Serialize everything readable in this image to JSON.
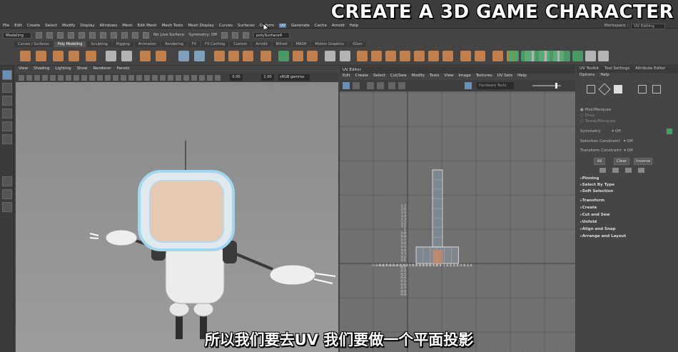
{
  "banner": "CREATE A 3D GAME CHARACTER",
  "menu": [
    "File",
    "Edit",
    "Create",
    "Select",
    "Modify",
    "Display",
    "Windows",
    "Mesh",
    "Edit Mesh",
    "Mesh Tools",
    "Mesh Display",
    "Curves",
    "Surfaces",
    "Deform",
    "UV",
    "Generate",
    "Cache",
    "Arnold",
    "Help"
  ],
  "menu_highlight": "UV",
  "workspace": {
    "label": "Workspace :",
    "value": "UV Editing"
  },
  "statusline": {
    "mode": "Modeling",
    "live_surface": "No Live Surface",
    "symmetry": "Symmetry: Off",
    "object": "polySurface4"
  },
  "shelf_tabs": [
    "Curves / Surfaces",
    "Poly Modeling",
    "Sculpting",
    "Rigging",
    "Animation",
    "Rendering",
    "FX",
    "FX Caching",
    "Custom",
    "Arnold",
    "Bifrost",
    "MASH",
    "Motion Graphics",
    "XGen"
  ],
  "shelf_active": "Poly Modeling",
  "viewport": {
    "menu": [
      "View",
      "Shading",
      "Lighting",
      "Show",
      "Renderer",
      "Panels"
    ],
    "field_a": "0.00",
    "field_b": "1.00",
    "color_mgmt": "sRGB gamma"
  },
  "uv_editor": {
    "title": "UV Editor",
    "menu": [
      "Edit",
      "Create",
      "Select",
      "Cut/Sew",
      "Modify",
      "Tools",
      "View",
      "Image",
      "Textures",
      "UV Sets",
      "Help"
    ],
    "tex_dropdown": "Hardware Texts",
    "x_labels": [
      "-1",
      "-0.9",
      "-0.8",
      "-0.7",
      "-0.6",
      "-0.5",
      "-0.4",
      "-0.3",
      "-0.2",
      "-0.1",
      "0",
      "0.1",
      "0.2",
      "0.3",
      "0.4",
      "0.5",
      "0.6",
      "0.7",
      "0.8",
      "0.9",
      "1",
      "1.1",
      "1.2",
      "1.3",
      "1.4",
      "1.5",
      "1.6",
      "1.7",
      "1.8"
    ],
    "y_labels": [
      "1.7",
      "1.6",
      "1.5",
      "1.4",
      "1.3",
      "1.2",
      "1.1",
      "1",
      "0.9",
      "0.8",
      "0.7",
      "0.6",
      "0.5",
      "0.4",
      "0.3",
      "0.2",
      "0.1",
      "-0.1",
      "-0.2",
      "-0.3",
      "-0.4",
      "-0.5",
      "-0.6",
      "-0.7",
      "-0.8",
      "-0.9"
    ]
  },
  "toolkit": {
    "tabs": [
      "UV Toolkit",
      "Tool Settings",
      "Attribute Editor"
    ],
    "menu": [
      "Options",
      "Help"
    ],
    "radios": [
      "Pick/Marquee",
      "Drag",
      "Tweak/Marquee"
    ],
    "symmetry_label": "Symmetry",
    "symmetry_value": "Off",
    "sel_constraint_label": "Selection Constraint",
    "sel_constraint_value": "Off",
    "transform_constraint_label": "Transform Constraint",
    "transform_constraint_value": "Off",
    "buttons": [
      "All",
      "Clear",
      "Inverse"
    ],
    "sections": [
      "Pinning",
      "Select By Type",
      "Soft Selection",
      "Transform",
      "Create",
      "Cut and Sew",
      "Unfold",
      "Align and Snap",
      "Arrange and Layout"
    ]
  },
  "subtitle": "所以我们要去UV 我们要做一个平面投影",
  "colors": {
    "uv_shell": "#9fb4c8",
    "uv_selected_face": "#c48a6a",
    "monitor_screen": "#e6c9b0",
    "monitor_rim": "#9fd8f0"
  }
}
